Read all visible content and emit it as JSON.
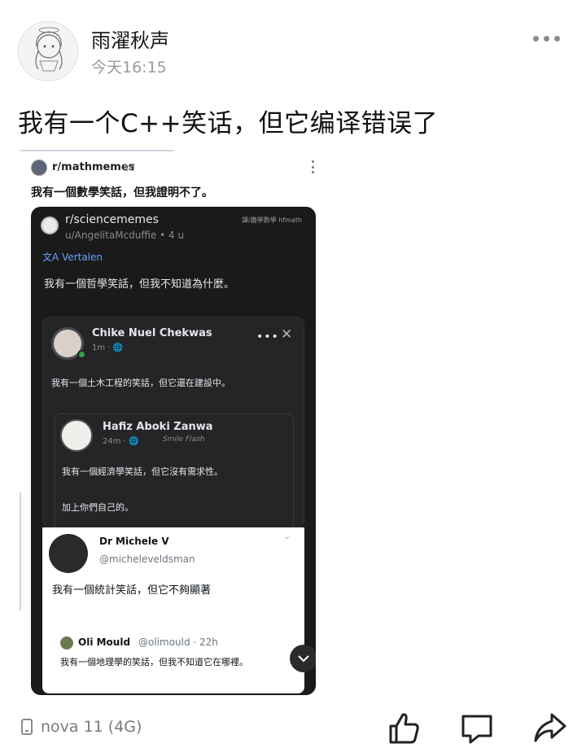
{
  "post": {
    "author": "雨濯秋声",
    "time": "今天16:15",
    "title": "我有一个C++笑话，但它编译错误了"
  },
  "reddit": {
    "subreddit": "r/mathmemes",
    "age": "1d",
    "caption": "我有一個數學笑話，但我證明不了。"
  },
  "science": {
    "subreddit": "r/sciencememes",
    "user": "u/AngelitaMcduffie • 4 u",
    "tag": "譯/趣學數學 hfmath",
    "translate": "Vertalen",
    "text": "我有一個哲學笑話，但我不知道為什麼。"
  },
  "facebook": {
    "name": "Chike Nuel Chekwas",
    "meta": "1m · 🌐",
    "text": "我有一個土木工程的笑話，但它還在建設中。",
    "nested": {
      "name": "Hafiz Aboki Zanwa",
      "meta": "24m · 🌐",
      "signature": "Smile Flash",
      "text1": "我有一個經濟學笑話，但它沒有需求性。",
      "text2": "加上你們自己的。"
    }
  },
  "twitter": {
    "name": "Dr Michele V",
    "handle": "@micheleveldsman",
    "text": "我有一個統計笑話，但它不夠顯著",
    "quote": {
      "name": "Oli Mould",
      "meta": "@olimould · 22h",
      "text": "我有一個地理學的笑話，但我不知道它在哪裡。"
    }
  },
  "footer": {
    "device": "nova 11 (4G)"
  }
}
